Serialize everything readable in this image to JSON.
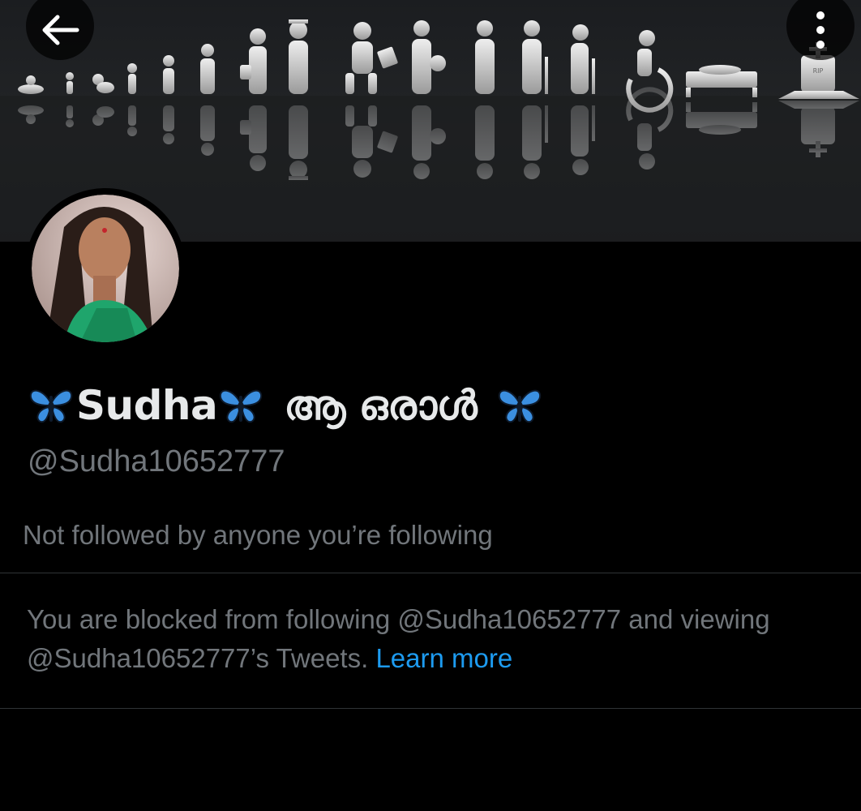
{
  "header": {
    "back_icon": "arrow-left-icon",
    "more_icon": "vertical-ellipsis-icon"
  },
  "banner": {
    "image": "life-stages-silhouettes",
    "tombstone_text": "RIP"
  },
  "profile": {
    "avatar": "profile-photo",
    "display_name_1": "Sudha",
    "display_name_2": "ആ ഒരാൾ",
    "emoji": "blue-butterfly",
    "handle": "@Sudha10652777",
    "followed_by_text": "Not followed by anyone you’re following"
  },
  "blocked_notice": {
    "text": "You are blocked from following @Sudha10652777 and viewing @Sudha10652777’s Tweets.",
    "link_label": "Learn more"
  },
  "colors": {
    "background": "#000000",
    "primary_text": "#e7e9ea",
    "secondary_text": "#71767b",
    "link": "#1d9bf0",
    "divider": "#2f3336",
    "butterfly": "#3b8fe0"
  }
}
